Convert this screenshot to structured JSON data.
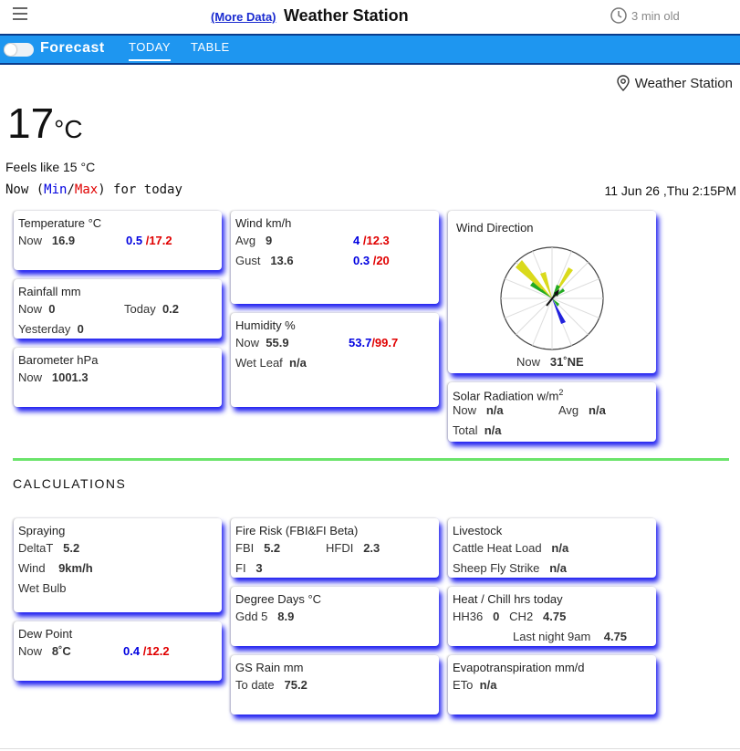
{
  "topbar": {
    "more_link": "(More Data)",
    "title": "Weather Station",
    "age": "3 min old"
  },
  "nav": {
    "forecast": "Forecast",
    "tabs": [
      "TODAY",
      "TABLE"
    ]
  },
  "header": {
    "location": "Weather Station",
    "temp": "17",
    "temp_unit": "°C",
    "feels": "Feels like 15 °C",
    "now_prefix": "Now (",
    "min_label": "Min",
    "slash": "/",
    "max_label": "Max",
    "now_suffix": ") for today",
    "datetime": "11 Jun 26 ,Thu 2:15PM"
  },
  "temperature": {
    "title": "Temperature °C",
    "now_label": "Now",
    "now": "16.9",
    "min": "0.5",
    "max": "/17.2"
  },
  "rainfall": {
    "title": "Rainfall mm",
    "now_label": "Now",
    "now": "0",
    "today_label": "Today",
    "today": "0.2",
    "yesterday_label": "Yesterday",
    "yesterday": "0"
  },
  "barometer": {
    "title": "Barometer hPa",
    "now_label": "Now",
    "now": "1001.3"
  },
  "wind": {
    "title": "Wind km/h",
    "avg_label": "Avg",
    "avg": "9",
    "avg_min": "4",
    "avg_max": "/12.3",
    "gust_label": "Gust",
    "gust": "13.6",
    "gust_min": "0.3",
    "gust_max": "/20"
  },
  "humidity": {
    "title": "Humidity %",
    "now_label": "Now",
    "now": "55.9",
    "min": "53.7",
    "max": "/99.7",
    "wetleaf_label": "Wet Leaf",
    "wetleaf": "n/a"
  },
  "wind_direction": {
    "title": "Wind Direction",
    "now_label": "Now",
    "now": "31˚NE"
  },
  "solar": {
    "title": "Solar Radiation w/m",
    "title_sup": "2",
    "now_label": "Now",
    "now": "n/a",
    "avg_label": "Avg",
    "avg": "n/a",
    "total_label": "Total",
    "total": "n/a"
  },
  "calculations": {
    "title": "CALCULATIONS"
  },
  "spraying": {
    "title": "Spraying",
    "deltat_label": "DeltaT",
    "deltat": "5.2",
    "wind_label": "Wind",
    "wind": "9km/h",
    "wetbulb_label": "Wet Bulb"
  },
  "dewpoint": {
    "title": "Dew Point",
    "now_label": "Now",
    "now": "8˚C",
    "min": "0.4",
    "max": "/12.2"
  },
  "firerisk": {
    "title": "Fire Risk (FBI&FI Beta)",
    "fbi_label": "FBI",
    "fbi": "5.2",
    "hfdi_label": "HFDI",
    "hfdi": "2.3",
    "fi_label": "FI",
    "fi": "3"
  },
  "degreedays": {
    "title": "Degree Days °C",
    "gdd_label": "Gdd 5",
    "gdd": "8.9"
  },
  "gsrain": {
    "title": "GS Rain mm",
    "todate_label": "To date",
    "todate": "75.2"
  },
  "livestock": {
    "title": "Livestock",
    "cattle_label": "Cattle Heat Load",
    "cattle": "n/a",
    "sheep_label": "Sheep Fly Strike",
    "sheep": "n/a"
  },
  "heatchill": {
    "title": "Heat / Chill hrs today",
    "hh36_label": "HH36",
    "hh36": "0",
    "ch2_label": "CH2",
    "ch2": "4.75",
    "lastnight_label": "Last night 9am",
    "lastnight": "4.75"
  },
  "evapo": {
    "title": "Evapotranspiration mm/d",
    "eto_label": "ETo",
    "eto": "n/a"
  },
  "colors": {
    "nav_bg": "#1e96f0",
    "min": "#0000e0",
    "max": "#e00000",
    "card_shadow": "#2020f0",
    "divider": "#6be46b"
  }
}
